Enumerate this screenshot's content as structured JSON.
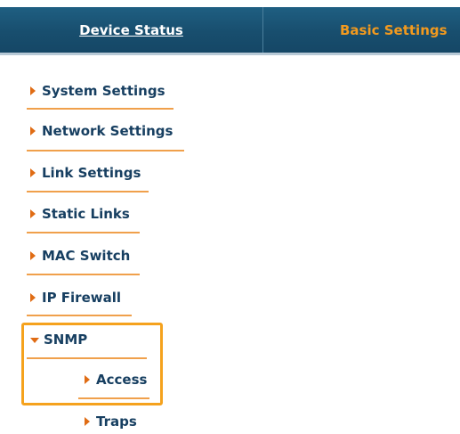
{
  "header": {
    "tabs": [
      {
        "label": "Device Status"
      },
      {
        "label": "Basic Settings"
      }
    ]
  },
  "menu": {
    "items": [
      {
        "label": "System Settings"
      },
      {
        "label": "Network Settings"
      },
      {
        "label": "Link Settings"
      },
      {
        "label": "Static Links"
      },
      {
        "label": "MAC Switch"
      },
      {
        "label": "IP Firewall"
      },
      {
        "label": "SNMP",
        "expanded": true
      }
    ],
    "snmp_subitems": [
      {
        "label": "Access",
        "selected": true
      },
      {
        "label": "Traps"
      }
    ]
  },
  "colors": {
    "header_bg": "#1b5576",
    "active_tab_text": "#f39a1e",
    "menu_text": "#173f61",
    "arrow": "#e06c14",
    "underline": "#f0a04b",
    "highlight": "#f5a21d"
  }
}
